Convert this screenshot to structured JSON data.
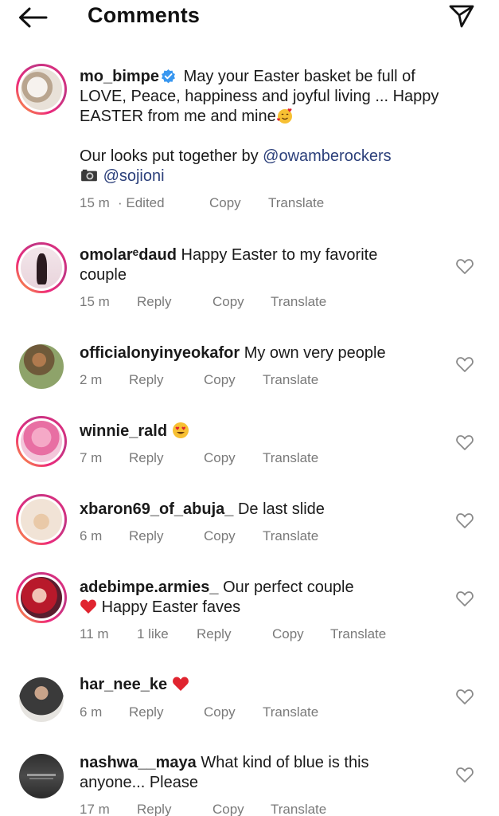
{
  "header": {
    "title": "Comments"
  },
  "caption": {
    "username": "mo_bimpe",
    "line1": "May your Easter basket be full of",
    "line2": "LOVE, Peace, happiness and joyful living ... Happy",
    "line3": "EASTER from me and mine",
    "line4_prefix": "Our looks put together by ",
    "line4_mention": "@owamberockers",
    "line5_mention": "@sojioni",
    "time": "15 m",
    "edited": "· Edited",
    "copy": "Copy",
    "translate": "Translate"
  },
  "comments": [
    {
      "username": "omolaredaud",
      "username_display": "omolarᵉdaud",
      "text": "Happy Easter to my favorite",
      "text2": "couple",
      "time": "15 m",
      "reply": "Reply",
      "copy": "Copy",
      "translate": "Translate"
    },
    {
      "username": "officialonyinyeokafor",
      "text": "My own very people",
      "time": "2 m",
      "reply": "Reply",
      "copy": "Copy",
      "translate": "Translate"
    },
    {
      "username": "winnie_rald",
      "time": "7 m",
      "reply": "Reply",
      "copy": "Copy",
      "translate": "Translate"
    },
    {
      "username": "xbaron69_of_abuja_",
      "text": "De last slide",
      "time": "6 m",
      "reply": "Reply",
      "copy": "Copy",
      "translate": "Translate"
    },
    {
      "username": "adebimpe.armies_",
      "text": "Our perfect couple",
      "text2": "Happy Easter faves",
      "time": "11 m",
      "likes": "1 like",
      "reply": "Reply",
      "copy": "Copy",
      "translate": "Translate"
    },
    {
      "username": "har_nee_ke",
      "time": "6 m",
      "reply": "Reply",
      "copy": "Copy",
      "translate": "Translate"
    },
    {
      "username": "nashwa__maya",
      "text": "What kind of blue is this",
      "text2": "anyone... Please",
      "time": "17 m",
      "reply": "Reply",
      "copy": "Copy",
      "translate": "Translate"
    }
  ],
  "colors": {
    "text": "#1a1a1a",
    "meta": "#7a7a7a",
    "link": "#2b3f7a",
    "verified": "#3897f0",
    "heart_red": "#e0242f"
  },
  "icons": [
    "back-arrow-icon",
    "send-icon",
    "verified-badge-icon",
    "heart-outline-icon",
    "camera-icon",
    "red-heart-emoji",
    "heart-eyes-emoji",
    "smiling-hearts-emoji"
  ]
}
